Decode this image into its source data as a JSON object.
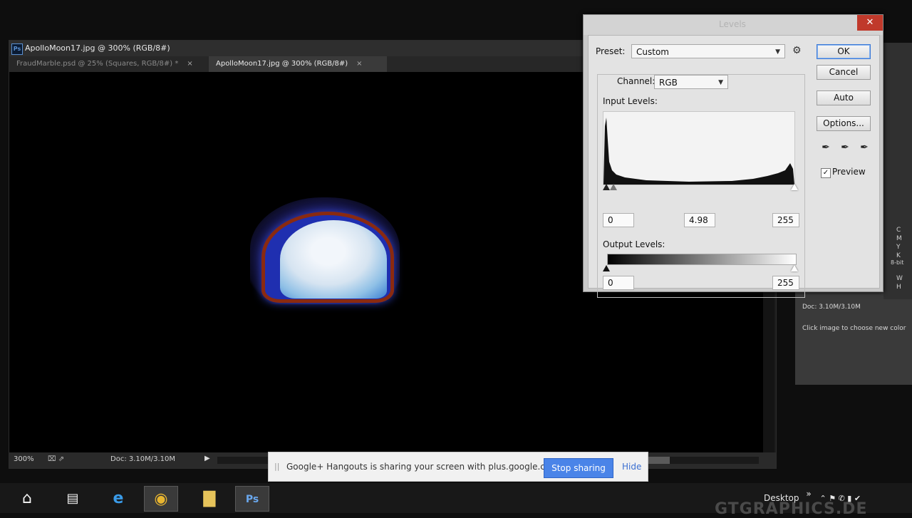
{
  "document": {
    "title": "ApolloMoon17.jpg @ 300% (RGB/8#)",
    "app_badge": "Ps",
    "tabs": [
      {
        "label": "FraudMarble.psd @ 25% (Squares, RGB/8#) *",
        "close": "×"
      },
      {
        "label": "ApolloMoon17.jpg @ 300% (RGB/8#)",
        "close": "×"
      }
    ],
    "status": {
      "zoom": "300%",
      "doc_size": "Doc: 3.10M/3.10M",
      "icons": "⌧ ⇗",
      "arrow": "▶"
    }
  },
  "side_panel": {
    "doc_size": "Doc: 3.10M/3.10M",
    "hint": "Click image to choose new color",
    "letters": [
      "C",
      "M",
      "Y",
      "K",
      "8-bit",
      "W",
      "H"
    ]
  },
  "levels": {
    "title": "Levels",
    "close": "✕",
    "preset_label": "Preset:",
    "preset_value": "Custom",
    "gear": "⚙",
    "channel_label": "Channel:",
    "channel_value": "RGB",
    "input_levels_label": "Input Levels:",
    "input_black": "0",
    "input_gamma": "4.98",
    "input_white": "255",
    "output_levels_label": "Output Levels:",
    "output_black": "0",
    "output_white": "255",
    "buttons": {
      "ok": "OK",
      "cancel": "Cancel",
      "auto": "Auto",
      "options": "Options..."
    },
    "preview_label": "Preview",
    "preview_checked": "✓",
    "eyedroppers": [
      "black-eyedropper-icon",
      "gray-eyedropper-icon",
      "white-eyedropper-icon"
    ]
  },
  "share_bar": {
    "grip": "||",
    "message": "Google+ Hangouts is sharing your screen with plus.google.com.",
    "stop_button": "Stop sharing",
    "hide_link": "Hide"
  },
  "taskbar": {
    "desktop_label": "Desktop",
    "desktop_chevron": "»",
    "tray": "⌃  ⚑  ✆  ▮  ✔",
    "watermark": "GTGRAPHICS.DE"
  }
}
